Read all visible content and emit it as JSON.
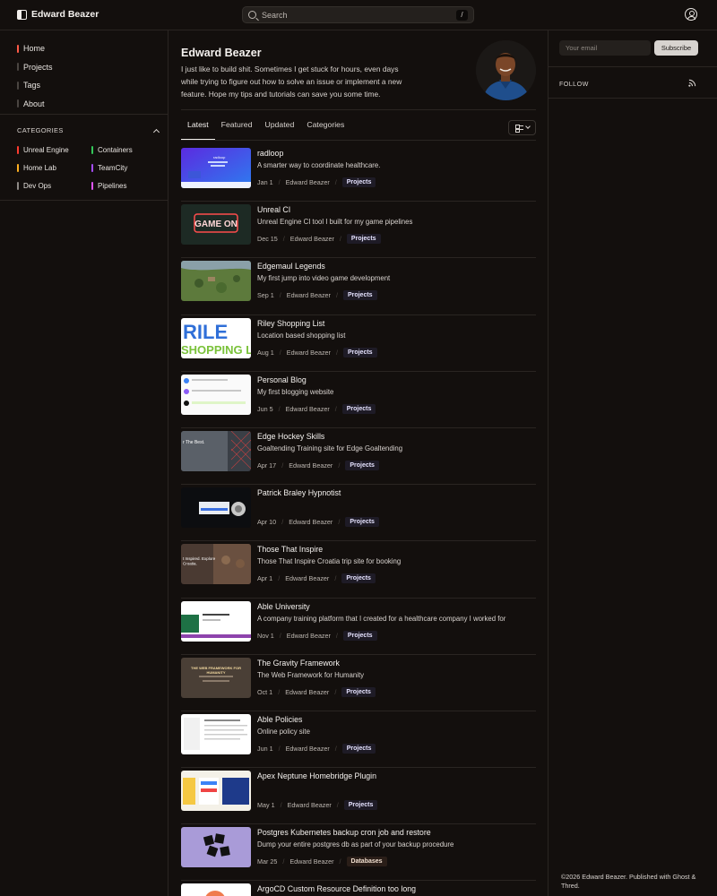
{
  "header": {
    "brand": "Edward Beazer",
    "search_placeholder": "Search",
    "search_shortcut": "/"
  },
  "sidebar": {
    "nav": [
      {
        "label": "Home",
        "active": true
      },
      {
        "label": "Projects"
      },
      {
        "label": "Tags"
      },
      {
        "label": "About"
      }
    ],
    "categories_heading": "CATEGORIES",
    "categories": [
      {
        "label": "Unreal Engine",
        "color": "#ff3b30"
      },
      {
        "label": "Containers",
        "color": "#34c759"
      },
      {
        "label": "Home Lab",
        "color": "#ffb020"
      },
      {
        "label": "TeamCity",
        "color": "#a64dff"
      },
      {
        "label": "Dev Ops",
        "color": "#8e8a86"
      },
      {
        "label": "Pipelines",
        "color": "#e056fd"
      }
    ]
  },
  "profile": {
    "name": "Edward Beazer",
    "bio": "I just like to build shit. Sometimes I get stuck for hours, even days while trying to figure out how to solve an issue or implement a new feature. Hope my tips and tutorials can save you some time."
  },
  "tabs": [
    "Latest",
    "Featured",
    "Updated",
    "Categories"
  ],
  "posts": [
    {
      "title": "radloop",
      "excerpt": "A smarter way to coordinate healthcare.",
      "date": "Jan 1",
      "author": "Edward Beazer",
      "tag": "Projects"
    },
    {
      "title": "Unreal CI",
      "excerpt": "Unreal Engine CI tool I built for my game pipelines",
      "date": "Dec 15",
      "author": "Edward Beazer",
      "tag": "Projects"
    },
    {
      "title": "Edgemaul Legends",
      "excerpt": "My first jump into video game development",
      "date": "Sep 1",
      "author": "Edward Beazer",
      "tag": "Projects"
    },
    {
      "title": "Riley Shopping List",
      "excerpt": "Location based shopping list",
      "date": "Aug 1",
      "author": "Edward Beazer",
      "tag": "Projects"
    },
    {
      "title": "Personal Blog",
      "excerpt": "My first blogging website",
      "date": "Jun 5",
      "author": "Edward Beazer",
      "tag": "Projects"
    },
    {
      "title": "Edge Hockey Skills",
      "excerpt": "Goaltending Training site for Edge Goaltending",
      "date": "Apr 17",
      "author": "Edward Beazer",
      "tag": "Projects"
    },
    {
      "title": "Patrick Braley Hypnotist",
      "excerpt": "",
      "date": "Apr 10",
      "author": "Edward Beazer",
      "tag": "Projects"
    },
    {
      "title": "Those That Inspire",
      "excerpt": "Those That Inspire Croatia trip site for booking",
      "date": "Apr 1",
      "author": "Edward Beazer",
      "tag": "Projects"
    },
    {
      "title": "Able University",
      "excerpt": "A company training platform that I created for a healthcare company I worked for",
      "date": "Nov 1",
      "author": "Edward Beazer",
      "tag": "Projects"
    },
    {
      "title": "The Gravity Framework",
      "excerpt": "The Web Framework for Humanity",
      "date": "Oct 1",
      "author": "Edward Beazer",
      "tag": "Projects"
    },
    {
      "title": "Able Policies",
      "excerpt": "Online policy site",
      "date": "Jun 1",
      "author": "Edward Beazer",
      "tag": "Projects"
    },
    {
      "title": "Apex Neptune Homebridge Plugin",
      "excerpt": "",
      "date": "May 1",
      "author": "Edward Beazer",
      "tag": "Projects"
    },
    {
      "title": "Postgres Kubernetes backup cron job and restore",
      "excerpt": "Dump your entire postgres db as part of your backup procedure",
      "date": "Mar 25",
      "author": "Edward Beazer",
      "tag": "Databases"
    },
    {
      "title": "ArgoCD Custom Resource Definition too long",
      "excerpt": "",
      "date": "",
      "author": "",
      "tag": ""
    }
  ],
  "thumb_text": {
    "radloop": "radloop",
    "game_on": "GAME ON",
    "riley_1": "RILE",
    "riley_2": "SHOPPING L",
    "edge": "r The Best.",
    "inspire": "t Inspired. Explore\nCroatia.",
    "gravity": "THE WEB FRAMEWORK FOR\nHUMANITY"
  },
  "right": {
    "email_placeholder": "Your email",
    "subscribe_label": "Subscribe",
    "follow_label": "FOLLOW",
    "footer": "©2026 Edward Beazer. Published with Ghost & Thred."
  }
}
